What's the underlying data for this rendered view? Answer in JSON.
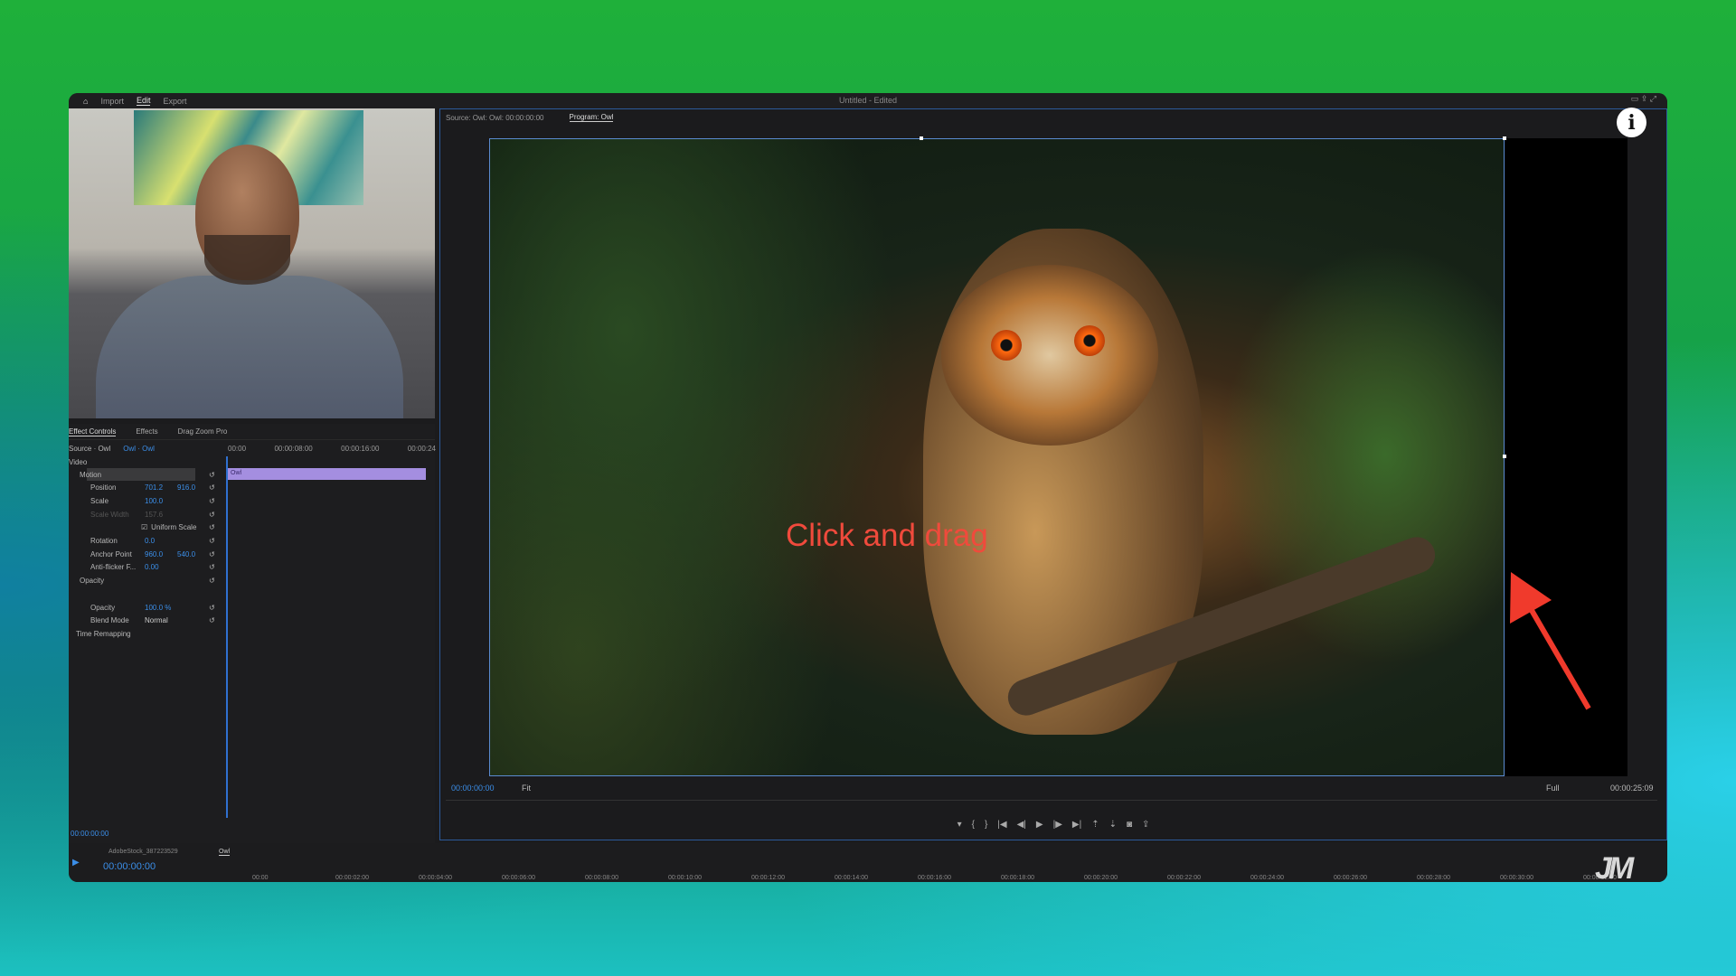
{
  "menu": {
    "items": [
      "Import",
      "Edit",
      "Export"
    ],
    "active": "Edit",
    "title": "Untitled - Edited"
  },
  "effect_controls": {
    "tabs": [
      "Effect Controls",
      "Effects",
      "Drag Zoom Pro"
    ],
    "source": "Source · Owl",
    "clip": "Owl · Owl",
    "ruler": [
      "00:00",
      "00:00:08:00",
      "00:00:16:00",
      "00:00:24"
    ],
    "clip_label": "Owl",
    "section_video": "Video",
    "rows": [
      {
        "label": "Motion",
        "v1": "",
        "v2": ""
      },
      {
        "label": "Position",
        "v1": "701.2",
        "v2": "916.0"
      },
      {
        "label": "Scale",
        "v1": "100.0",
        "v2": ""
      },
      {
        "label": "Scale Width",
        "v1": "157.6",
        "v2": ""
      },
      {
        "label": "Uniform Scale",
        "v1": "",
        "v2": ""
      },
      {
        "label": "Rotation",
        "v1": "0.0",
        "v2": ""
      },
      {
        "label": "Anchor Point",
        "v1": "960.0",
        "v2": "540.0"
      },
      {
        "label": "Anti-flicker F...",
        "v1": "0.00",
        "v2": ""
      },
      {
        "label": "Opacity",
        "v1": "",
        "v2": ""
      },
      {
        "label": "",
        "v1": "",
        "v2": ""
      },
      {
        "label": "Opacity",
        "v1": "100.0 %",
        "v2": ""
      },
      {
        "label": "Blend Mode",
        "v1": "Normal",
        "v2": ""
      },
      {
        "label": "Time Remapping",
        "v1": "",
        "v2": ""
      }
    ],
    "timecode": "00:00:00:00"
  },
  "program": {
    "tabs": [
      "Source: Owl: Owl: 00:00:00:00",
      "Program: Owl"
    ],
    "active_tab": "Program: Owl",
    "timecode": "00:00:00:00",
    "fit": "Fit",
    "quality": "Full",
    "duration": "00:00:25:09",
    "overlay_text": "Click and drag",
    "overlay_color": "#f04a3c"
  },
  "timeline": {
    "tabs": [
      "AdobeStock_387223529",
      "Owl"
    ],
    "timecode": "00:00:00:00",
    "ticks": [
      "00:00",
      "00:00:02:00",
      "00:00:04:00",
      "00:00:06:00",
      "00:00:08:00",
      "00:00:10:00",
      "00:00:12:00",
      "00:00:14:00",
      "00:00:16:00",
      "00:00:18:00",
      "00:00:20:00",
      "00:00:22:00",
      "00:00:24:00",
      "00:00:26:00",
      "00:00:28:00",
      "00:00:30:00",
      "00:00:32:00"
    ]
  },
  "info_icon": "i",
  "logo": "JM"
}
